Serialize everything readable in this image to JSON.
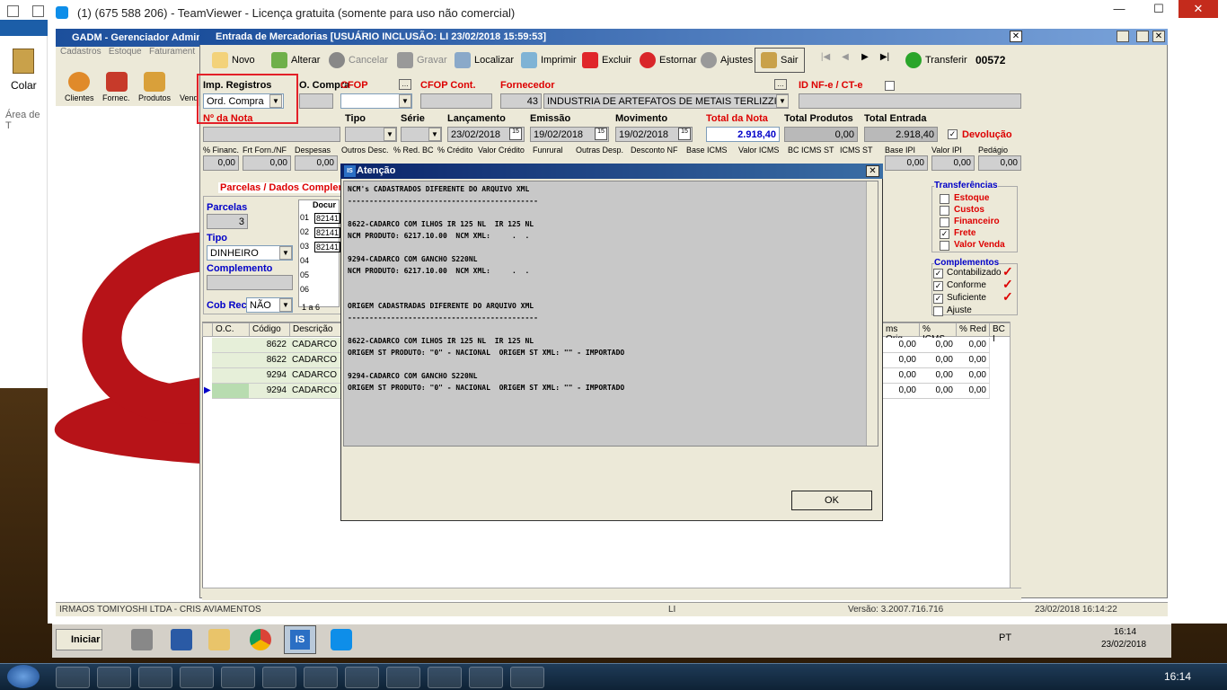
{
  "teamviewer": {
    "title": "(1) (675 588 206) - TeamViewer - Licença gratuita (somente para uso não comercial)"
  },
  "desktop": {
    "colar_label": "Colar",
    "area_label": "Área de T"
  },
  "gadm": {
    "title": "GADM - Gerenciador Admin",
    "menu": [
      "Cadastros",
      "Estoque",
      "Faturament"
    ],
    "icons": [
      "Clientes",
      "Fornec.",
      "Produtos",
      "Vend"
    ]
  },
  "window": {
    "title": "Entrada de Mercadorias  [USUÁRIO INCLUSÃO: LI 23/02/2018 15:59:53]",
    "toolbar": {
      "novo": "Novo",
      "alterar": "Alterar",
      "cancelar": "Cancelar",
      "gravar": "Gravar",
      "localizar": "Localizar",
      "imprimir": "Imprimir",
      "excluir": "Excluir",
      "estornar": "Estornar",
      "ajustes": "Ajustes",
      "sair": "Sair",
      "transferir": "Transferir",
      "record": "00572"
    },
    "form": {
      "imp_registros": "Imp. Registros",
      "ord_compra": "Ord. Compra",
      "o_compra": "O. Compra",
      "cfop": "CFOP",
      "cfop_cont": "CFOP Cont.",
      "fornecedor": "Fornecedor",
      "fornecedor_code": "43",
      "fornecedor_name": "INDUSTRIA DE ARTEFATOS DE METAIS TERLIZZI",
      "id_nfe": "ID NF-e / CT-e",
      "nr_nota": "Nº da Nota",
      "tipo": "Tipo",
      "serie": "Série",
      "lancamento": "Lançamento",
      "lancamento_val": "23/02/2018",
      "emissao": "Emissão",
      "emissao_val": "19/02/2018",
      "movimento": "Movimento",
      "movimento_val": "19/02/2018",
      "total_nota": "Total da Nota",
      "total_nota_val": "2.918,40",
      "total_produtos": "Total Produtos",
      "total_produtos_val": "0,00",
      "total_entrada": "Total Entrada",
      "total_entrada_val": "2.918,40",
      "devolucao": "Devolução"
    },
    "row3": {
      "labels": [
        "% Financ.",
        "Frt Forn./NF",
        "Despesas",
        "Outros Desc.",
        "% Red. BC",
        "% Crédito",
        "Valor Crédito",
        "Funrural",
        "Outras Desp.",
        "Desconto NF",
        "Base ICMS",
        "Valor ICMS",
        "BC ICMS ST",
        "ICMS ST",
        "Base IPI",
        "Valor IPI",
        "Pedágio"
      ],
      "values": [
        "0,00",
        "0,00",
        "0,00",
        "0,00",
        "0,00",
        "0,00"
      ]
    },
    "parcelas": {
      "tab": "Parcelas / Dados Complem",
      "parcelas_lbl": "Parcelas",
      "parcelas_val": "3",
      "tipo_lbl": "Tipo",
      "tipo_val": "DINHEIRO",
      "complemento_lbl": "Complemento",
      "cob_rec_lbl": "Cob Rec",
      "cob_rec_val": "NÃO",
      "docum_hdr": "Docur",
      "rows": [
        "01",
        "02",
        "03",
        "04",
        "05",
        "06"
      ],
      "docs": [
        "82141",
        "82141",
        "82141"
      ],
      "pager": "1 a 6"
    },
    "transferencias": {
      "title": "Transferências",
      "items": [
        "Estoque",
        "Custos",
        "Financeiro",
        "Frete",
        "Valor Venda"
      ]
    },
    "complementos": {
      "title": "Complementos",
      "items": [
        "Contabilizado",
        "Conforme",
        "Suficiente",
        "Ajuste"
      ]
    },
    "grid": {
      "headers": [
        "O.C.",
        "Código",
        "Descrição"
      ],
      "right_headers": [
        "ms Orig.",
        "% ICMS",
        "% Red",
        "BC I"
      ],
      "rows": [
        {
          "code": "8622",
          "desc": "CADARCO"
        },
        {
          "code": "8622",
          "desc": "CADARCO"
        },
        {
          "code": "9294",
          "desc": "CADARCO"
        },
        {
          "code": "9294",
          "desc": "CADARCO"
        }
      ],
      "zero": "0,00"
    },
    "status": {
      "left": "IRMAOS TOMIYOSHI LTDA  -  CRIS AVIAMENTOS",
      "mid": "LI",
      "version": "Versão: 3.2007.716.716",
      "datetime": "23/02/2018 16:14:22"
    }
  },
  "dialog": {
    "title": "Atenção",
    "lines": [
      "NCM's CADASTRADOS DIFERENTE DO ARQUIVO XML",
      "--------------------------------------------",
      "",
      "8622-CADARCO COM ILHOS IR 125 NL  IR 125 NL",
      "NCM PRODUTO: 6217.10.00  NCM XML:     .  .",
      "",
      "9294-CADARCO COM GANCHO S220NL",
      "NCM PRODUTO: 6217.10.00  NCM XML:     .  .",
      "",
      "",
      "ORIGEM CADASTRADAS DIFERENTE DO ARQUIVO XML",
      "--------------------------------------------",
      "",
      "8622-CADARCO COM ILHOS IR 125 NL  IR 125 NL",
      "ORIGEM ST PRODUTO: \"0\" - NACIONAL  ORIGEM ST XML: \"\" - IMPORTADO",
      "",
      "9294-CADARCO COM GANCHO S220NL",
      "ORIGEM ST PRODUTO: \"0\" - NACIONAL  ORIGEM ST XML: \"\" - IMPORTADO"
    ],
    "ok": "OK"
  },
  "remote_taskbar": {
    "start": "Iniciar",
    "lang": "PT",
    "time": "16:14",
    "date": "23/02/2018"
  },
  "taskbar": {
    "time": "16:14"
  }
}
